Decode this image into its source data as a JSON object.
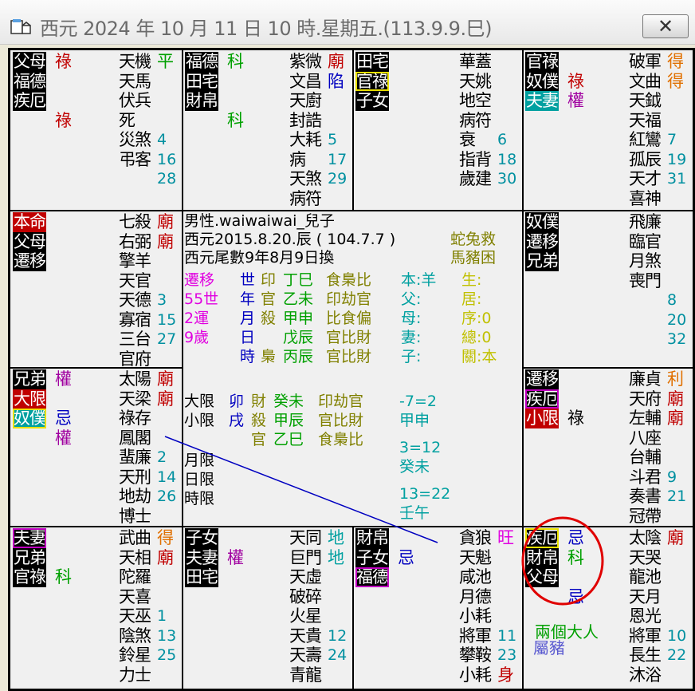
{
  "window": {
    "title": "西元 2024 年 10 月 11 日 10 時.星期五.(113.9.9.巳)",
    "close_label": "✕"
  },
  "palaces": [
    {
      "id": "tl",
      "labels": [
        {
          "t": "父母",
          "c": "black"
        },
        {
          "t": "福德",
          "c": "black"
        },
        {
          "t": "疾厄",
          "c": "black"
        }
      ],
      "marks": [
        {
          "t": "祿",
          "c": "#c00000",
          "row": 0
        },
        {
          "t": "祿",
          "c": "#c00000",
          "row": 3
        }
      ],
      "stars": [
        {
          "t": "天機",
          "s": "平",
          "sc": "#00a000"
        },
        {
          "t": "天馬"
        },
        {
          "t": "伏兵"
        },
        {
          "t": "死"
        },
        {
          "t": "災煞",
          "n": "4"
        },
        {
          "t": "弔客",
          "n": "16"
        },
        {
          "t": "",
          "n": "28"
        }
      ]
    },
    {
      "id": "tm1",
      "labels": [
        {
          "t": "福德",
          "c": "black"
        },
        {
          "t": "田宅",
          "c": "black"
        },
        {
          "t": "財帛",
          "c": "black"
        }
      ],
      "marks": [
        {
          "t": "科",
          "c": "#00a000",
          "row": 0
        },
        {
          "t": "科",
          "c": "#00a000",
          "row": 3
        }
      ],
      "stars": [
        {
          "t": "紫微",
          "s": "廟",
          "sc": "#c00000"
        },
        {
          "t": "文昌",
          "s": "陷",
          "sc": "#0000c0"
        },
        {
          "t": "天廚"
        },
        {
          "t": "封誥"
        },
        {
          "t": "大耗",
          "n": "5"
        },
        {
          "t": "病",
          "n": "17"
        },
        {
          "t": "天煞",
          "n": "29"
        },
        {
          "t": "病符"
        }
      ]
    },
    {
      "id": "tm2",
      "labels": [
        {
          "t": "田宅",
          "c": "black"
        },
        {
          "t": "官祿",
          "c": "ybox"
        },
        {
          "t": "子女",
          "c": "black"
        }
      ],
      "marks": [],
      "stars": [
        {
          "t": "華蓋"
        },
        {
          "t": "天姚"
        },
        {
          "t": "地空"
        },
        {
          "t": "病符"
        },
        {
          "t": "衰",
          "n": "6"
        },
        {
          "t": "指背",
          "n": "18"
        },
        {
          "t": "歲建",
          "n": "30"
        }
      ]
    },
    {
      "id": "tr",
      "labels": [
        {
          "t": "官祿",
          "c": "black"
        },
        {
          "t": "奴僕",
          "c": "black"
        },
        {
          "t": "夫妻",
          "c": "teal"
        }
      ],
      "marks": [
        {
          "t": "祿",
          "c": "#c00000",
          "row": 1
        },
        {
          "t": "權",
          "c": "#a000a0",
          "row": 2
        }
      ],
      "stars": [
        {
          "t": "破軍",
          "s": "得",
          "sc": "#e07000"
        },
        {
          "t": "文曲",
          "s": "得",
          "sc": "#e07000"
        },
        {
          "t": "天鉞"
        },
        {
          "t": "天福"
        },
        {
          "t": "紅鸞",
          "n": "7"
        },
        {
          "t": "孤辰",
          "n": "19"
        },
        {
          "t": "天才",
          "n": "31"
        },
        {
          "t": "喜神"
        }
      ]
    },
    {
      "id": "ml",
      "labels": [
        {
          "t": "本命",
          "c": "red"
        },
        {
          "t": "父母",
          "c": "black"
        },
        {
          "t": "遷移",
          "c": "black"
        }
      ],
      "marks": [],
      "stars": [
        {
          "t": "七殺",
          "s": "廟",
          "sc": "#c00000"
        },
        {
          "t": "右弼",
          "s": "廟",
          "sc": "#c00000"
        },
        {
          "t": "擎羊"
        },
        {
          "t": "天官"
        },
        {
          "t": "天德",
          "n": "3"
        },
        {
          "t": "寡宿",
          "n": "15"
        },
        {
          "t": "三台",
          "n": "27"
        },
        {
          "t": "官府"
        }
      ]
    },
    {
      "id": "mr",
      "labels": [
        {
          "t": "奴僕",
          "c": "black"
        },
        {
          "t": "遷移",
          "c": "black"
        },
        {
          "t": "兄弟",
          "c": "black"
        }
      ],
      "marks": [],
      "stars": [
        {
          "t": "飛廉"
        },
        {
          "t": "臨官"
        },
        {
          "t": "月煞"
        },
        {
          "t": "喪門"
        },
        {
          "t": "",
          "n": "8"
        },
        {
          "t": "",
          "n": "20"
        },
        {
          "t": "",
          "n": "32"
        }
      ]
    },
    {
      "id": "ll",
      "labels": [
        {
          "t": "兄弟",
          "c": "black"
        },
        {
          "t": "大限",
          "c": "red"
        },
        {
          "t": "奴僕",
          "c": "teal ybox"
        }
      ],
      "marks": [
        {
          "t": "權",
          "c": "#a000a0",
          "row": 0
        },
        {
          "t": "忌",
          "c": "#0000c0",
          "row": 2
        },
        {
          "t": "權",
          "c": "#a000a0",
          "row": 3
        }
      ],
      "stars": [
        {
          "t": "太陽",
          "s": "廟",
          "sc": "#c00000"
        },
        {
          "t": "天梁",
          "s": "廟",
          "sc": "#c00000"
        },
        {
          "t": "祿存"
        },
        {
          "t": "鳳閣"
        },
        {
          "t": "蜚廉",
          "n": "2"
        },
        {
          "t": "天刑",
          "n": "14"
        },
        {
          "t": "地劫",
          "n": "26"
        },
        {
          "t": "博士"
        }
      ]
    },
    {
      "id": "lr",
      "labels": [
        {
          "t": "遷移",
          "c": "black"
        },
        {
          "t": "疾厄",
          "c": "pbox"
        },
        {
          "t": "小限",
          "c": "red"
        }
      ],
      "marks": [
        {
          "t": "祿",
          "c": "#000",
          "row": 2
        }
      ],
      "stars": [
        {
          "t": "廉貞",
          "s": "利",
          "sc": "#e07000"
        },
        {
          "t": "天府",
          "s": "廟",
          "sc": "#c00000"
        },
        {
          "t": "左輔",
          "s": "廟",
          "sc": "#c00000"
        },
        {
          "t": "八座"
        },
        {
          "t": "台輔"
        },
        {
          "t": "斗君",
          "n": "9"
        },
        {
          "t": "奏書",
          "n": "21"
        },
        {
          "t": "冠帶"
        }
      ]
    },
    {
      "id": "bl",
      "labels": [
        {
          "t": "夫妻",
          "c": "pbox"
        },
        {
          "t": "兄弟",
          "c": "black"
        },
        {
          "t": "官祿",
          "c": "black"
        }
      ],
      "marks": [
        {
          "t": "科",
          "c": "#00a000",
          "row": 2
        }
      ],
      "stars": [
        {
          "t": "武曲",
          "s": "得",
          "sc": "#e07000"
        },
        {
          "t": "天相",
          "s": "廟",
          "sc": "#c00000"
        },
        {
          "t": "陀羅"
        },
        {
          "t": "天喜"
        },
        {
          "t": "天巫",
          "n": "1"
        },
        {
          "t": "陰煞",
          "n": "13"
        },
        {
          "t": "鈴星",
          "n": "25"
        },
        {
          "t": "力士"
        }
      ]
    },
    {
      "id": "bm1",
      "labels": [
        {
          "t": "子女",
          "c": "black"
        },
        {
          "t": "夫妻",
          "c": "black"
        },
        {
          "t": "田宅",
          "c": "black"
        }
      ],
      "marks": [
        {
          "t": "權",
          "c": "#a000a0",
          "row": 1
        }
      ],
      "stars": [
        {
          "t": "天同",
          "s": "地",
          "sc": "#00a0a0"
        },
        {
          "t": "巨門",
          "s": "地",
          "sc": "#00a0a0"
        },
        {
          "t": "天虛"
        },
        {
          "t": "破碎"
        },
        {
          "t": "火星"
        },
        {
          "t": "天貴",
          "n": "12"
        },
        {
          "t": "天壽",
          "n": "24"
        },
        {
          "t": "青龍"
        }
      ]
    },
    {
      "id": "bm2",
      "labels": [
        {
          "t": "財帛",
          "c": "black"
        },
        {
          "t": "子女",
          "c": "black"
        },
        {
          "t": "福德",
          "c": "pbox"
        }
      ],
      "marks": [
        {
          "t": "忌",
          "c": "#0000c0",
          "row": 1
        }
      ],
      "stars": [
        {
          "t": "貪狼",
          "s": "旺",
          "sc": "#e000e0"
        },
        {
          "t": "天魁"
        },
        {
          "t": "咸池"
        },
        {
          "t": "月德"
        },
        {
          "t": "小耗"
        },
        {
          "t": "將軍",
          "n": "11"
        },
        {
          "t": "攀鞍",
          "n": "23"
        },
        {
          "t": "小耗",
          "s": "身",
          "sc": "#c00000"
        }
      ]
    },
    {
      "id": "br",
      "labels": [
        {
          "t": "疾厄",
          "c": "ybox"
        },
        {
          "t": "財帛",
          "c": "black"
        },
        {
          "t": "父母",
          "c": "black"
        }
      ],
      "marks": [
        {
          "t": "忌",
          "c": "#0000c0",
          "row": 0
        },
        {
          "t": "科",
          "c": "#00a000",
          "row": 1
        },
        {
          "t": "忌",
          "c": "#0000c0",
          "row": 3
        }
      ],
      "stars": [
        {
          "t": "太陰",
          "s": "廟",
          "sc": "#c00000"
        },
        {
          "t": "天哭"
        },
        {
          "t": "龍池"
        },
        {
          "t": "天月"
        },
        {
          "t": "恩光"
        },
        {
          "t": "將軍",
          "n": "10"
        },
        {
          "t": "長生",
          "n": "22"
        },
        {
          "t": "沐浴"
        }
      ]
    }
  ],
  "center": {
    "line1": "男性.waiwaiwai_兒子",
    "line2": "西元2015.8.20.辰 ( 104.7.7 )",
    "line3": "西元尾數9年8月9日換",
    "tag1": "蛇兔救",
    "tag2": "馬豬困",
    "left_col": [
      "遷移",
      "55世",
      "2運",
      "9歲"
    ],
    "pillar_labels": [
      "世",
      "年",
      "月",
      "日",
      "時"
    ],
    "pillars": [
      {
        "a": "印",
        "b": "丁巳",
        "c": "食梟比"
      },
      {
        "a": "官",
        "b": "乙未",
        "c": "印劫官"
      },
      {
        "a": "殺",
        "b": "甲申",
        "c": "比食偏"
      },
      {
        "a": "",
        "b": "戊辰",
        "c": "官比財"
      },
      {
        "a": "梟",
        "b": "丙辰",
        "c": "官比財"
      }
    ],
    "rel": [
      "本:羊",
      "父:",
      "母:",
      "妻:",
      "子:"
    ],
    "stat": [
      "生:",
      "居:",
      "序:0",
      "總:0",
      "關:本"
    ],
    "limits": [
      {
        "k": "大限",
        "a": "卯",
        "b": "財",
        "c": "癸未",
        "d": "印劫官"
      },
      {
        "k": "小限",
        "a": "戌",
        "b": "殺",
        "c": "甲辰",
        "d": "官比財"
      },
      {
        "k": "",
        "a": "",
        "b": "官",
        "c": "乙巳",
        "d": "食梟比"
      }
    ],
    "small": [
      "月限",
      "日限",
      "時限"
    ],
    "calc": [
      "-7=2",
      "甲申",
      "3=12",
      "癸未",
      "13=22",
      "壬午"
    ]
  },
  "annotation": {
    "text1": "兩個大人",
    "text2": "屬豬"
  },
  "colors": {
    "red": "#c00000",
    "green": "#00a000",
    "blue": "#0000c0",
    "purple": "#a000a0",
    "teal": "#00a0a0",
    "olive": "#808000",
    "magenta": "#e000e0",
    "orange": "#e07000",
    "circle": "#e00000",
    "line": "#0000c0"
  }
}
